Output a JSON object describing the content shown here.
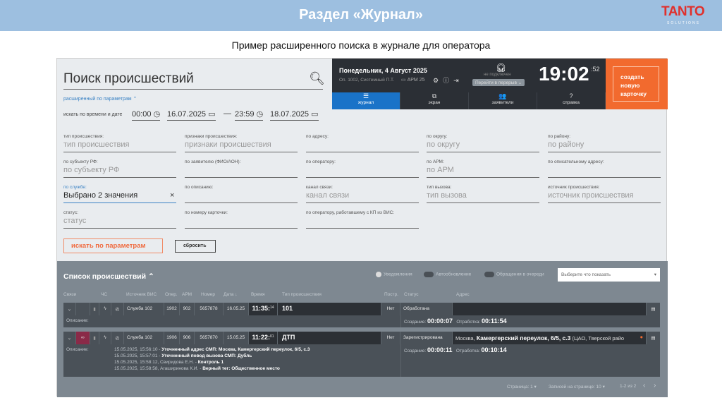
{
  "slide": {
    "title": "Раздел «Журнал»",
    "subtitle": "Пример расширенного поиска в журнале для оператора",
    "logo": "TANTO",
    "logo_sub": "SOLUTIONS"
  },
  "search": {
    "title": "Поиск происшествий",
    "advanced": "расширенный по параметрам ⌃",
    "time_label": "искать по времени и дате",
    "time_from": "00:00",
    "date_from": "16.07.2025",
    "dash": "—",
    "time_to": "23:59",
    "date_to": "18.07.2025"
  },
  "fields": [
    {
      "label": "тип происшествия:",
      "value": "тип происшествия"
    },
    {
      "label": "признаки происшествия:",
      "value": "признаки происшествия"
    },
    {
      "label": "по адресу:",
      "value": ""
    },
    {
      "label": "по округу:",
      "value": "по округу"
    },
    {
      "label": "по району:",
      "value": "по району"
    },
    {
      "label": "по субъекту РФ:",
      "value": "по субъекту РФ"
    },
    {
      "label": "по заявителю (ФИО/АОН):",
      "value": ""
    },
    {
      "label": "по оператору:",
      "value": ""
    },
    {
      "label": "по АРМ:",
      "value": "по АРМ"
    },
    {
      "label": "по описательному адресу:",
      "value": ""
    },
    {
      "label": "по службе:",
      "value": "Выбрано 2 значения"
    },
    {
      "label": "по описанию:",
      "value": ""
    },
    {
      "label": "канал связи:",
      "value": "канал связи"
    },
    {
      "label": "тип вызова:",
      "value": "тип вызова"
    },
    {
      "label": "источник происшествия:",
      "value": "источник происшествия"
    },
    {
      "label": "статус:",
      "value": "статус"
    },
    {
      "label": "по номеру карточки:",
      "value": ""
    },
    {
      "label": "по оператору, работавшему с КП из ВИС:",
      "value": ""
    }
  ],
  "buttons": {
    "search": "искать по параметрам",
    "reset": "сбросить",
    "clear": "×"
  },
  "header": {
    "date": "Понедельник, 4 Август 2025",
    "operator": "Оп. 1002, Системный П.Т.",
    "arm": "АРМ 25",
    "status": "не подключен",
    "break": "Перейти в перерыв ⌄",
    "clock": "19:02",
    "seconds": ":52",
    "create": "создать новую карточку",
    "tabs": [
      {
        "label": "журнал",
        "icon": "☰"
      },
      {
        "label": "экран",
        "icon": "⧉"
      },
      {
        "label": "заявители",
        "icon": "👥"
      },
      {
        "label": "справка",
        "icon": "?"
      }
    ]
  },
  "list": {
    "title": "Список происшествий ⌃",
    "notifications": "Уведомления",
    "autoupdate": "Автообновление",
    "queue": "Обращения в очереди",
    "select_placeholder": "Выберите что показать",
    "columns": [
      "Связи",
      "ЧС",
      "Источник ВИС",
      "Опер.",
      "АРМ",
      "Номер",
      "Дата ↓",
      "Время",
      "Тип происшествия",
      "Постр.",
      "Статус",
      "Адрес"
    ],
    "rows": [
      {
        "source": "Служба 102",
        "oper": "1902",
        "arm": "902",
        "number": "5657878",
        "date": "16.05.25",
        "time": "11:35:",
        "time_sec": "14",
        "type": "101",
        "postr": "Нет",
        "status": "Обработана",
        "address": "",
        "desc_label": "Описание:",
        "desc": [],
        "created_label": "Создание:",
        "created": "00:00:07",
        "worked_label": "Отработка:",
        "worked": "00:11:54"
      },
      {
        "source": "Служба 102",
        "oper": "1906",
        "arm": "906",
        "number": "5657870",
        "date": "15.05.25",
        "time": "11:22:",
        "time_sec": "01",
        "type": "ДТП",
        "postr": "Нет",
        "status": "Зарегистрирована",
        "address_pre": "Москва, ",
        "address": "Камергерский переулок, 6/5, с.3",
        "address_post": " (ЦАО, Тверской райо",
        "desc_label": "Описание:",
        "desc": [
          {
            "ts": "15.05.2025, 15:56:10 - ",
            "text": "Уточненный адрес СМП: Москва, Камергерский переулок, 6/5, с.3"
          },
          {
            "ts": "15.05.2025, 15:57:01 - ",
            "text": "Уточненный повод вызова СМП: Дубль"
          },
          {
            "ts": "15.05.2025, 15:58:12, Свиридова Е.Н. - ",
            "text": "Контроль 1"
          },
          {
            "ts": "15.05.2025, 15:58:58, Агаширинова К.И. - ",
            "text": "Верный тег: Общественное место"
          }
        ],
        "created_label": "Создание:",
        "created": "00:00:11",
        "worked_label": "Отработка:",
        "worked": "00:10:14"
      }
    ]
  },
  "pagination": {
    "page": "Страница: 1 ▾",
    "per_page": "Записей на странице: 10 ▾",
    "range": "1-2 из 2",
    "prev": "‹",
    "next": "›"
  }
}
